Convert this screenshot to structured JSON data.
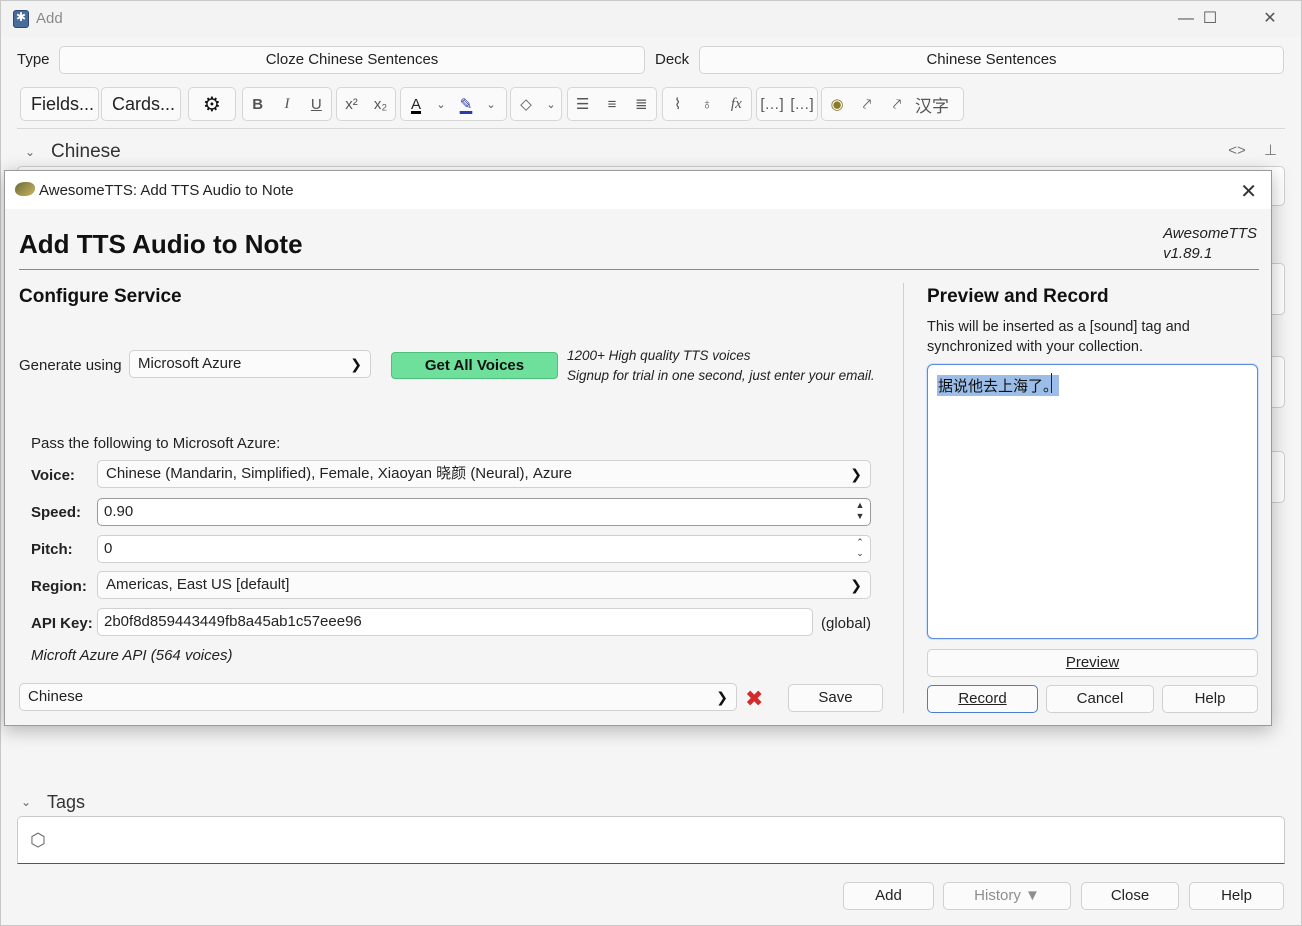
{
  "main": {
    "title": "Add",
    "type_label": "Type",
    "type_value": "Cloze Chinese Sentences",
    "deck_label": "Deck",
    "deck_value": "Chinese Sentences",
    "fields_btn": "Fields...",
    "cards_btn": "Cards...",
    "field_name": "Chinese",
    "tags_label": "Tags",
    "buttons": {
      "add": "Add",
      "history": "History ▼",
      "close": "Close",
      "help": "Help"
    },
    "toolbar_icons": [
      "gear-icon",
      "bold-icon",
      "italic-icon",
      "underline-icon",
      "superscript-icon",
      "subscript-icon",
      "text-color-icon",
      "highlight-icon",
      "eraser-icon",
      "bullet-list-icon",
      "numbered-list-icon",
      "align-icon",
      "attach-icon",
      "microphone-icon",
      "formula-icon",
      "cloze-icon",
      "cloze-same-icon",
      "awesometts-icon",
      "tts-icon",
      "tts-alt-icon",
      "hanzi-icon"
    ],
    "hanzi_label": "汉字"
  },
  "dialog": {
    "title": "AwesomeTTS: Add TTS Audio to Note",
    "heading": "Add TTS Audio to Note",
    "version_line1": "AwesomeTTS",
    "version_line2": "v1.89.1",
    "configure_heading": "Configure Service",
    "generate_label": "Generate using",
    "service": "Microsoft Azure",
    "get_voices_btn": "Get All Voices",
    "promo_line1": "1200+ High quality TTS voices",
    "promo_line2": "Signup for trial in one second, just enter your email.",
    "pass_label": "Pass the following to Microsoft Azure:",
    "voice_label": "Voice:",
    "voice_value": "Chinese (Mandarin, Simplified), Female, Xiaoyan 晓颜 (Neural), Azure",
    "speed_label": "Speed:",
    "speed_value": "0.90",
    "pitch_label": "Pitch:",
    "pitch_value": "0",
    "region_label": "Region:",
    "region_value": "Americas, East US [default]",
    "apikey_label": "API Key:",
    "apikey_value": "2b0f8d859443449fb8a45ab1c57eee96",
    "apikey_scope": "(global)",
    "api_info": "Microft Azure API (564 voices)",
    "preset_value": "Chinese",
    "save_btn": "Save",
    "preview_heading": "Preview and Record",
    "preview_desc": "This will be inserted as a [sound] tag and synchronized with your collection.",
    "preview_text": "据说他去上海了。",
    "preview_btn": "Preview",
    "record_btn": "Record",
    "cancel_btn": "Cancel",
    "help_btn": "Help"
  }
}
